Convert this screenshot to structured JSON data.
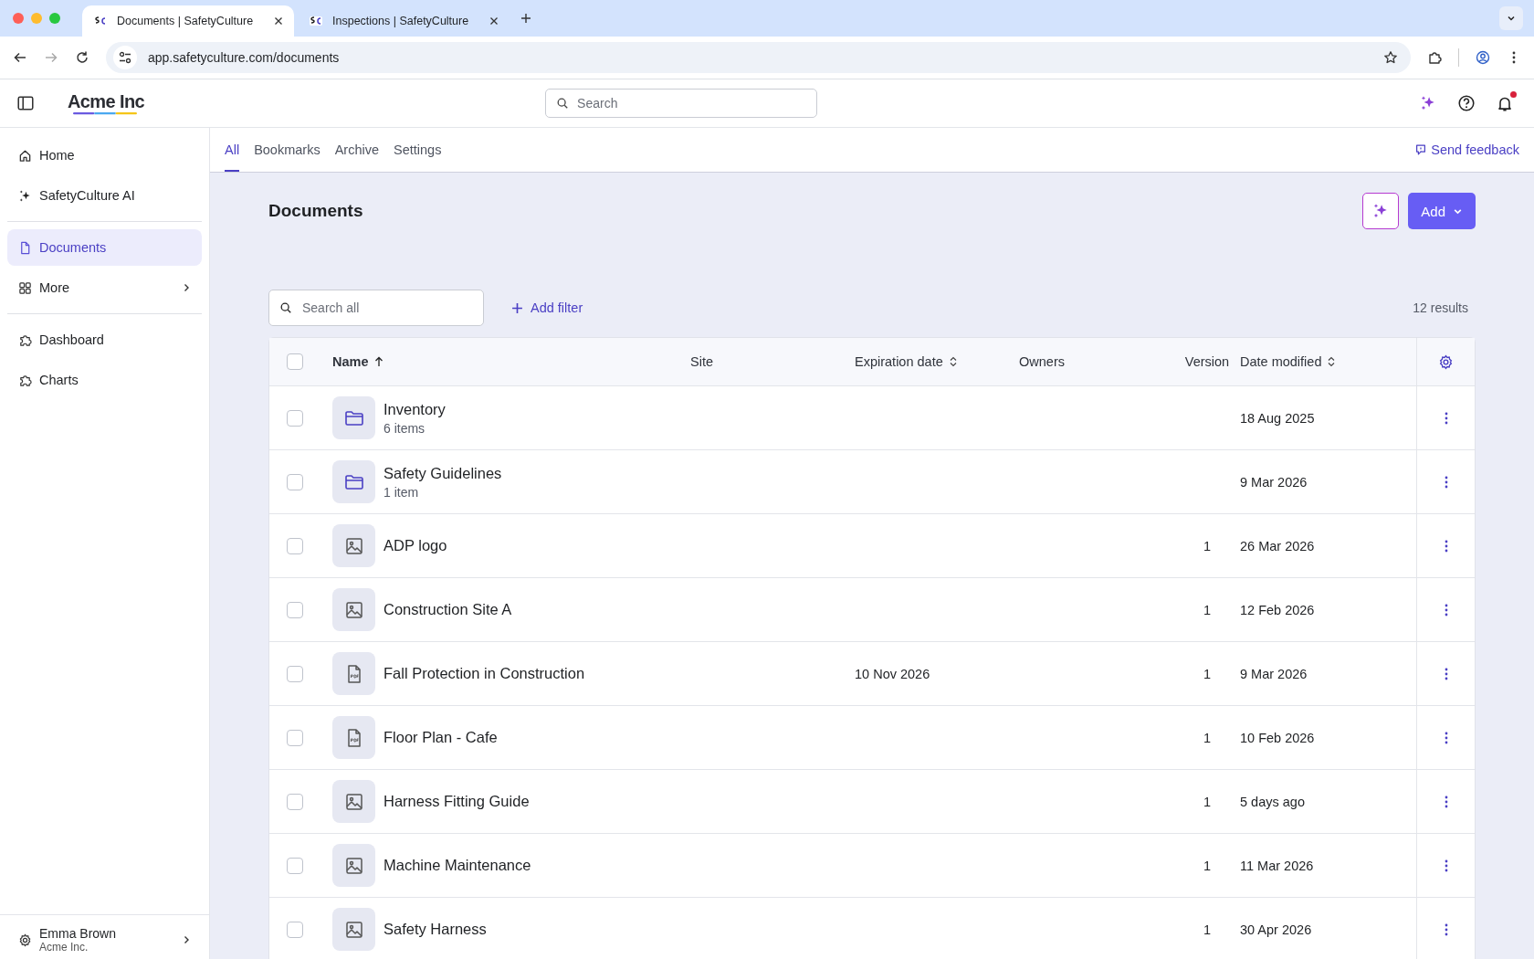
{
  "browser": {
    "tabs": [
      {
        "title": "Documents | SafetyCulture",
        "selected": true
      },
      {
        "title": "Inspections | SafetyCulture",
        "selected": false
      }
    ],
    "url": "app.safetyculture.com/documents"
  },
  "header": {
    "brand": "Acme Inc",
    "search": {
      "placeholder": "Search"
    },
    "notification_dot": true
  },
  "sidebar": {
    "groups": [
      [
        {
          "label": "Home",
          "selected": false,
          "has_submenu": false
        },
        {
          "label": "SafetyCulture AI",
          "selected": false,
          "has_submenu": false
        }
      ],
      [
        {
          "label": "Documents",
          "selected": true,
          "has_submenu": false
        },
        {
          "label": "More",
          "selected": false,
          "has_submenu": true
        }
      ],
      [
        {
          "label": "Dashboard",
          "selected": false,
          "has_submenu": false
        },
        {
          "label": "Charts",
          "selected": false,
          "has_submenu": false
        }
      ]
    ],
    "user": {
      "name": "Emma Brown",
      "org": "Acme Inc."
    }
  },
  "tabs": [
    {
      "label": "All",
      "selected": true
    },
    {
      "label": "Bookmarks",
      "selected": false
    },
    {
      "label": "Archive",
      "selected": false
    },
    {
      "label": "Settings",
      "selected": false
    }
  ],
  "feedback": "Send feedback",
  "page": {
    "title": "Documents",
    "add_button": "Add",
    "search": {
      "placeholder": "Search all"
    },
    "add_filter": "Add filter",
    "results": "12 results"
  },
  "table": {
    "select_all_checked": false,
    "columns": [
      {
        "label": "Name",
        "sorted": true,
        "sortable": true
      },
      {
        "label": "Site",
        "sorted": false,
        "sortable": false
      },
      {
        "label": "Expiration date",
        "sorted": false,
        "sortable": true
      },
      {
        "label": "Owners",
        "sorted": false,
        "sortable": false
      },
      {
        "label": "Version",
        "sorted": false,
        "sortable": false
      },
      {
        "label": "Date modified",
        "sorted": false,
        "sortable": true
      }
    ],
    "rows": [
      {
        "kind": "folder",
        "name": "Inventory",
        "subtitle": "6 items",
        "modified": "18 Aug 2025",
        "checked": false
      },
      {
        "kind": "folder",
        "name": "Safety Guidelines",
        "subtitle": "1 item",
        "modified": "9 Mar 2026",
        "checked": false
      },
      {
        "kind": "image",
        "name": "ADP logo",
        "version": "1",
        "modified": "26 Mar 2026",
        "checked": false
      },
      {
        "kind": "image",
        "name": "Construction Site A",
        "version": "1",
        "modified": "12 Feb 2026",
        "checked": false
      },
      {
        "kind": "pdf",
        "name": "Fall Protection in Construction",
        "expiration": "10 Nov 2026",
        "version": "1",
        "modified": "9 Mar 2026",
        "checked": false
      },
      {
        "kind": "pdf",
        "name": "Floor Plan - Cafe",
        "version": "1",
        "modified": "10 Feb 2026",
        "checked": false
      },
      {
        "kind": "image",
        "name": "Harness Fitting Guide",
        "version": "1",
        "modified": "5 days ago",
        "checked": false
      },
      {
        "kind": "image",
        "name": "Machine Maintenance",
        "version": "1",
        "modified": "11 Mar 2026",
        "checked": false
      },
      {
        "kind": "image",
        "name": "Safety Harness",
        "version": "1",
        "modified": "30 Apr 2026",
        "checked": false
      }
    ]
  }
}
